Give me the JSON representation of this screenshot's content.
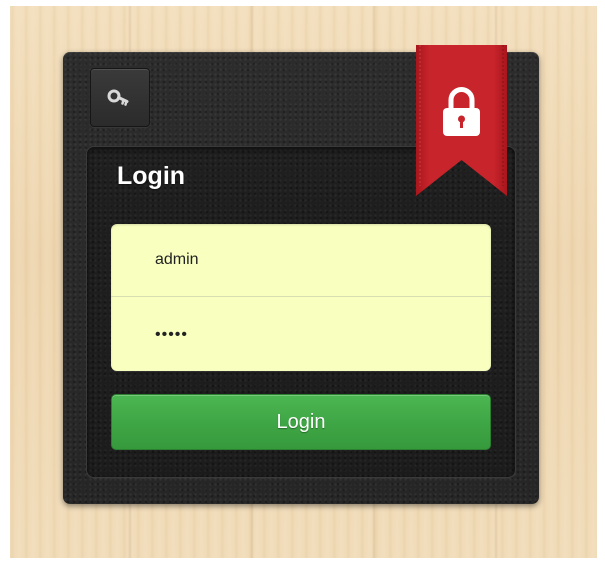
{
  "form": {
    "title": "Login",
    "username_value": "admin",
    "password_value": "12345",
    "submit_label": "Login"
  },
  "icons": {
    "key": "key-icon",
    "lock": "lock-icon"
  },
  "colors": {
    "ribbon": "#c8242b",
    "field_background": "#f9ffbf",
    "button": "#3ea544",
    "panel": "#282828",
    "background_wood": "#f0dab5"
  }
}
